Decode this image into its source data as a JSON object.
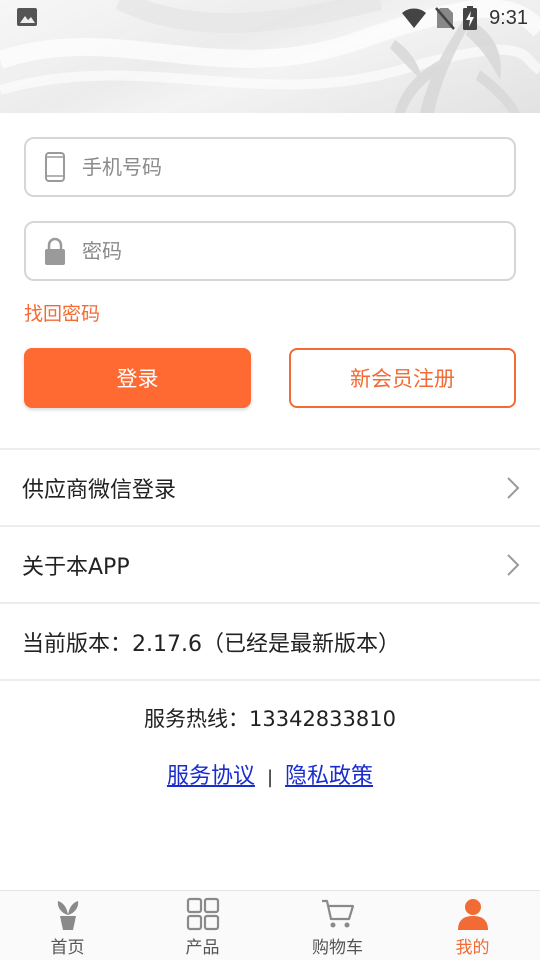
{
  "status_bar": {
    "time": "9:31"
  },
  "login": {
    "phone_placeholder": "手机号码",
    "password_placeholder": "密码",
    "forgot_password": "找回密码",
    "login_button": "登录",
    "register_button": "新会员注册"
  },
  "menu": {
    "supplier_wechat_login": "供应商微信登录",
    "about_app": "关于本APP",
    "current_version": "当前版本：2.17.6（已经是最新版本）"
  },
  "footer": {
    "hotline": "服务热线：13342833810",
    "service_agreement": "服务协议",
    "separator": "|",
    "privacy_policy": "隐私政策"
  },
  "bottom_nav": {
    "items": [
      {
        "label": "首页",
        "icon": "plant-icon",
        "active": false
      },
      {
        "label": "产品",
        "icon": "grid-icon",
        "active": false
      },
      {
        "label": "购物车",
        "icon": "cart-icon",
        "active": false
      },
      {
        "label": "我的",
        "icon": "user-icon",
        "active": true
      }
    ]
  },
  "colors": {
    "accent": "#ff6a33",
    "accent_text": "#f26b34",
    "link": "#1a2ccf",
    "inactive": "#8a8a8a"
  }
}
